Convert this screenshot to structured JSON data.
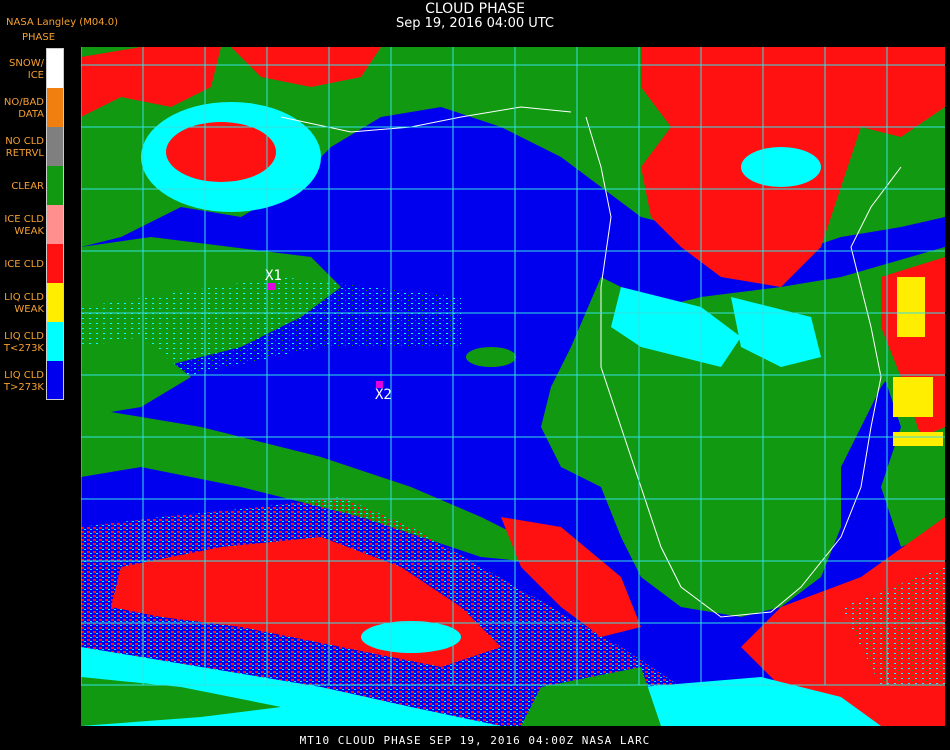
{
  "header": {
    "title": "CLOUD PHASE",
    "subtitle": "Sep 19, 2016 04:00 UTC",
    "provider": "NASA Langley (M04.0)"
  },
  "legend": {
    "title": "PHASE",
    "items": [
      {
        "label": "SNOW/\nICE",
        "color": "#ffffff"
      },
      {
        "label": "NO/BAD\nDATA",
        "color": "#f07f0f"
      },
      {
        "label": "NO CLD\nRETRVL",
        "color": "#7f7f7f"
      },
      {
        "label": "CLEAR",
        "color": "#119a11"
      },
      {
        "label": "ICE CLD\nWEAK",
        "color": "#ff8f8f"
      },
      {
        "label": "ICE CLD",
        "color": "#ff1111"
      },
      {
        "label": "LIQ CLD\nWEAK",
        "color": "#ffee00"
      },
      {
        "label": "LIQ CLD\nT<273K",
        "color": "#00ffff"
      },
      {
        "label": "LIQ CLD\nT>273K",
        "color": "#0000ee"
      }
    ]
  },
  "markers": [
    {
      "label": "X1"
    },
    {
      "label": "X2"
    }
  ],
  "colors": {
    "land": "#119a11",
    "ocean": "#0000ee",
    "ice_cloud": "#ff1111",
    "liquid_cold": "#00ffff",
    "grid": "#33e0e0",
    "coast": "#ffffff",
    "marker": "#e000e0",
    "text_accent": "#f5a032"
  },
  "footer": {
    "text": "MT10  CLOUD PHASE   SEP 19, 2016 04:00Z   NASA LARC"
  }
}
